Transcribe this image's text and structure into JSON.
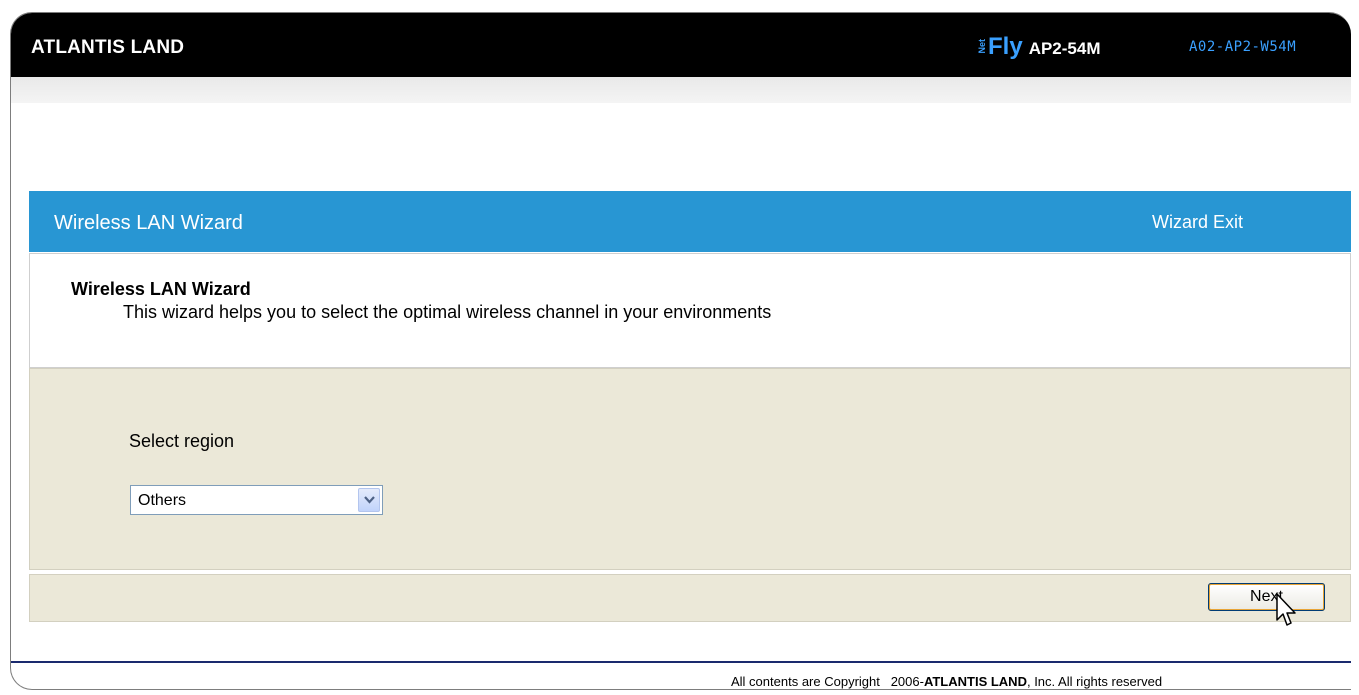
{
  "header": {
    "brand": "ATLANTIS LAND",
    "product_prefix": "Net",
    "product_name": "Fly",
    "model": "AP2-54M",
    "model_code": "A02-AP2-W54M"
  },
  "wizard": {
    "title": "Wireless LAN Wizard",
    "exit_label": "Wizard Exit",
    "heading": "Wireless LAN Wizard",
    "description": "This wizard helps you to select the optimal wireless channel in your environments",
    "region_label": "Select region",
    "region_selected": "Others",
    "next_label": "Next"
  },
  "footer": {
    "prefix": "All contents are Copyright   2006-",
    "company": "ATLANTIS LAND",
    "suffix": ", Inc. All rights reserved"
  },
  "colors": {
    "header_bg": "#000000",
    "accent_blue": "#2896d3",
    "panel_beige": "#ebe8d8",
    "logo_blue": "#3aa0ff"
  },
  "icons": [
    "chevron-down-icon",
    "mouse-pointer-icon"
  ]
}
